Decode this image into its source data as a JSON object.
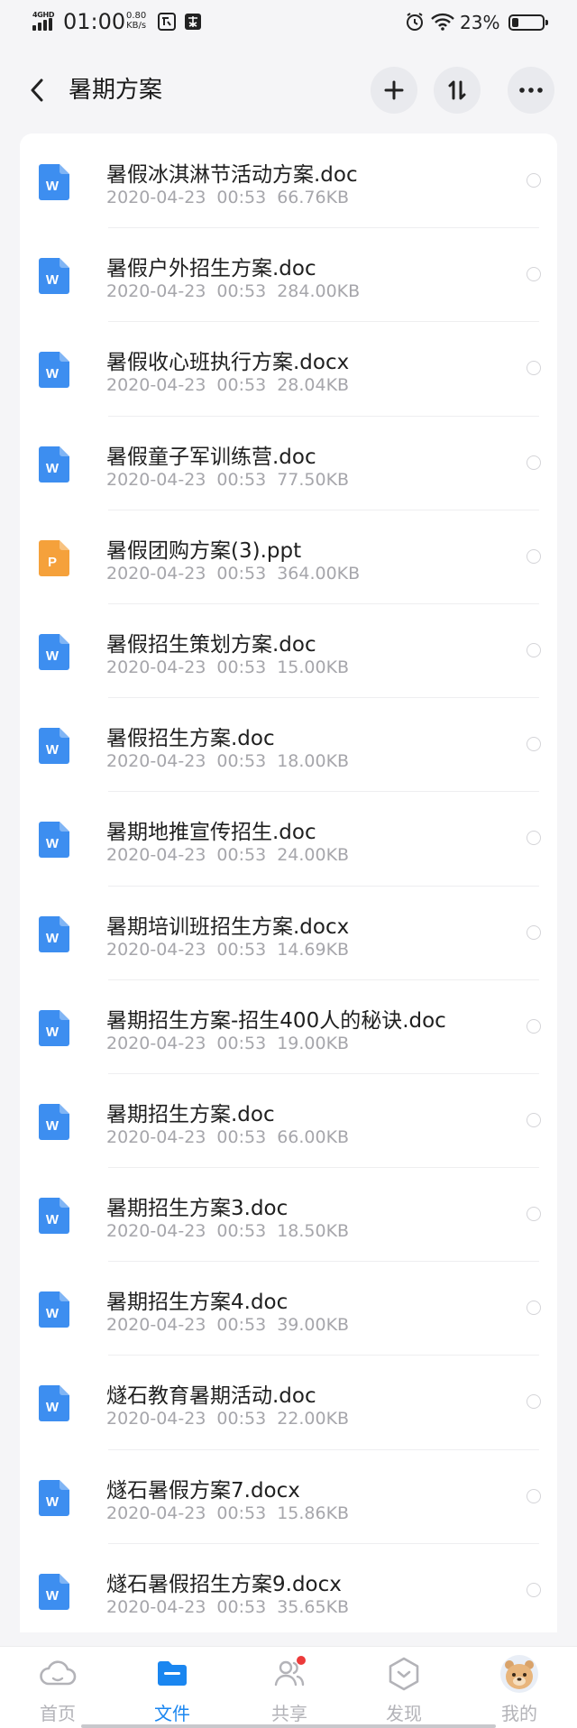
{
  "status_bar": {
    "network": "4GHD",
    "time": "01:00",
    "speed_value": "0.80",
    "speed_unit": "KB/s",
    "battery_percent": "23%",
    "battery_level": 0.23
  },
  "header": {
    "title": "暑期方案"
  },
  "files": [
    {
      "name": "暑假冰淇淋节活动方案.doc",
      "date": "2020-04-23",
      "time": "00:53",
      "size": "66.76KB",
      "type": "word"
    },
    {
      "name": "暑假户外招生方案.doc",
      "date": "2020-04-23",
      "time": "00:53",
      "size": "284.00KB",
      "type": "word"
    },
    {
      "name": "暑假收心班执行方案.docx",
      "date": "2020-04-23",
      "time": "00:53",
      "size": "28.04KB",
      "type": "word"
    },
    {
      "name": "暑假童子军训练营.doc",
      "date": "2020-04-23",
      "time": "00:53",
      "size": "77.50KB",
      "type": "word"
    },
    {
      "name": "暑假团购方案(3).ppt",
      "date": "2020-04-23",
      "time": "00:53",
      "size": "364.00KB",
      "type": "ppt"
    },
    {
      "name": "暑假招生策划方案.doc",
      "date": "2020-04-23",
      "time": "00:53",
      "size": "15.00KB",
      "type": "word"
    },
    {
      "name": "暑假招生方案.doc",
      "date": "2020-04-23",
      "time": "00:53",
      "size": "18.00KB",
      "type": "word"
    },
    {
      "name": "暑期地推宣传招生.doc",
      "date": "2020-04-23",
      "time": "00:53",
      "size": "24.00KB",
      "type": "word"
    },
    {
      "name": "暑期培训班招生方案.docx",
      "date": "2020-04-23",
      "time": "00:53",
      "size": "14.69KB",
      "type": "word"
    },
    {
      "name": "暑期招生方案-招生400人的秘诀.doc",
      "date": "2020-04-23",
      "time": "00:53",
      "size": "19.00KB",
      "type": "word"
    },
    {
      "name": "暑期招生方案.doc",
      "date": "2020-04-23",
      "time": "00:53",
      "size": "66.00KB",
      "type": "word"
    },
    {
      "name": "暑期招生方案3.doc",
      "date": "2020-04-23",
      "time": "00:53",
      "size": "18.50KB",
      "type": "word"
    },
    {
      "name": "暑期招生方案4.doc",
      "date": "2020-04-23",
      "time": "00:53",
      "size": "39.00KB",
      "type": "word"
    },
    {
      "name": "燧石教育暑期活动.doc",
      "date": "2020-04-23",
      "time": "00:53",
      "size": "22.00KB",
      "type": "word"
    },
    {
      "name": "燧石暑假方案7.docx",
      "date": "2020-04-23",
      "time": "00:53",
      "size": "15.86KB",
      "type": "word"
    },
    {
      "name": "燧石暑假招生方案9.docx",
      "date": "2020-04-23",
      "time": "00:53",
      "size": "35.65KB",
      "type": "word"
    }
  ],
  "file_icons": {
    "word_letter": "W",
    "ppt_letter": "P",
    "word_color": "#3d8ef0",
    "ppt_color": "#f5a13b"
  },
  "bottom_nav": [
    {
      "label": "首页",
      "icon": "cloud-icon",
      "active": false
    },
    {
      "label": "文件",
      "icon": "folder-icon",
      "active": true
    },
    {
      "label": "共享",
      "icon": "people-icon",
      "active": false,
      "badge": true
    },
    {
      "label": "发现",
      "icon": "discover-icon",
      "active": false
    },
    {
      "label": "我的",
      "icon": "avatar-icon",
      "active": false
    }
  ],
  "colors": {
    "accent": "#1a86f0",
    "badge": "#ec3a3a",
    "muted_text": "#a6a6ab"
  }
}
